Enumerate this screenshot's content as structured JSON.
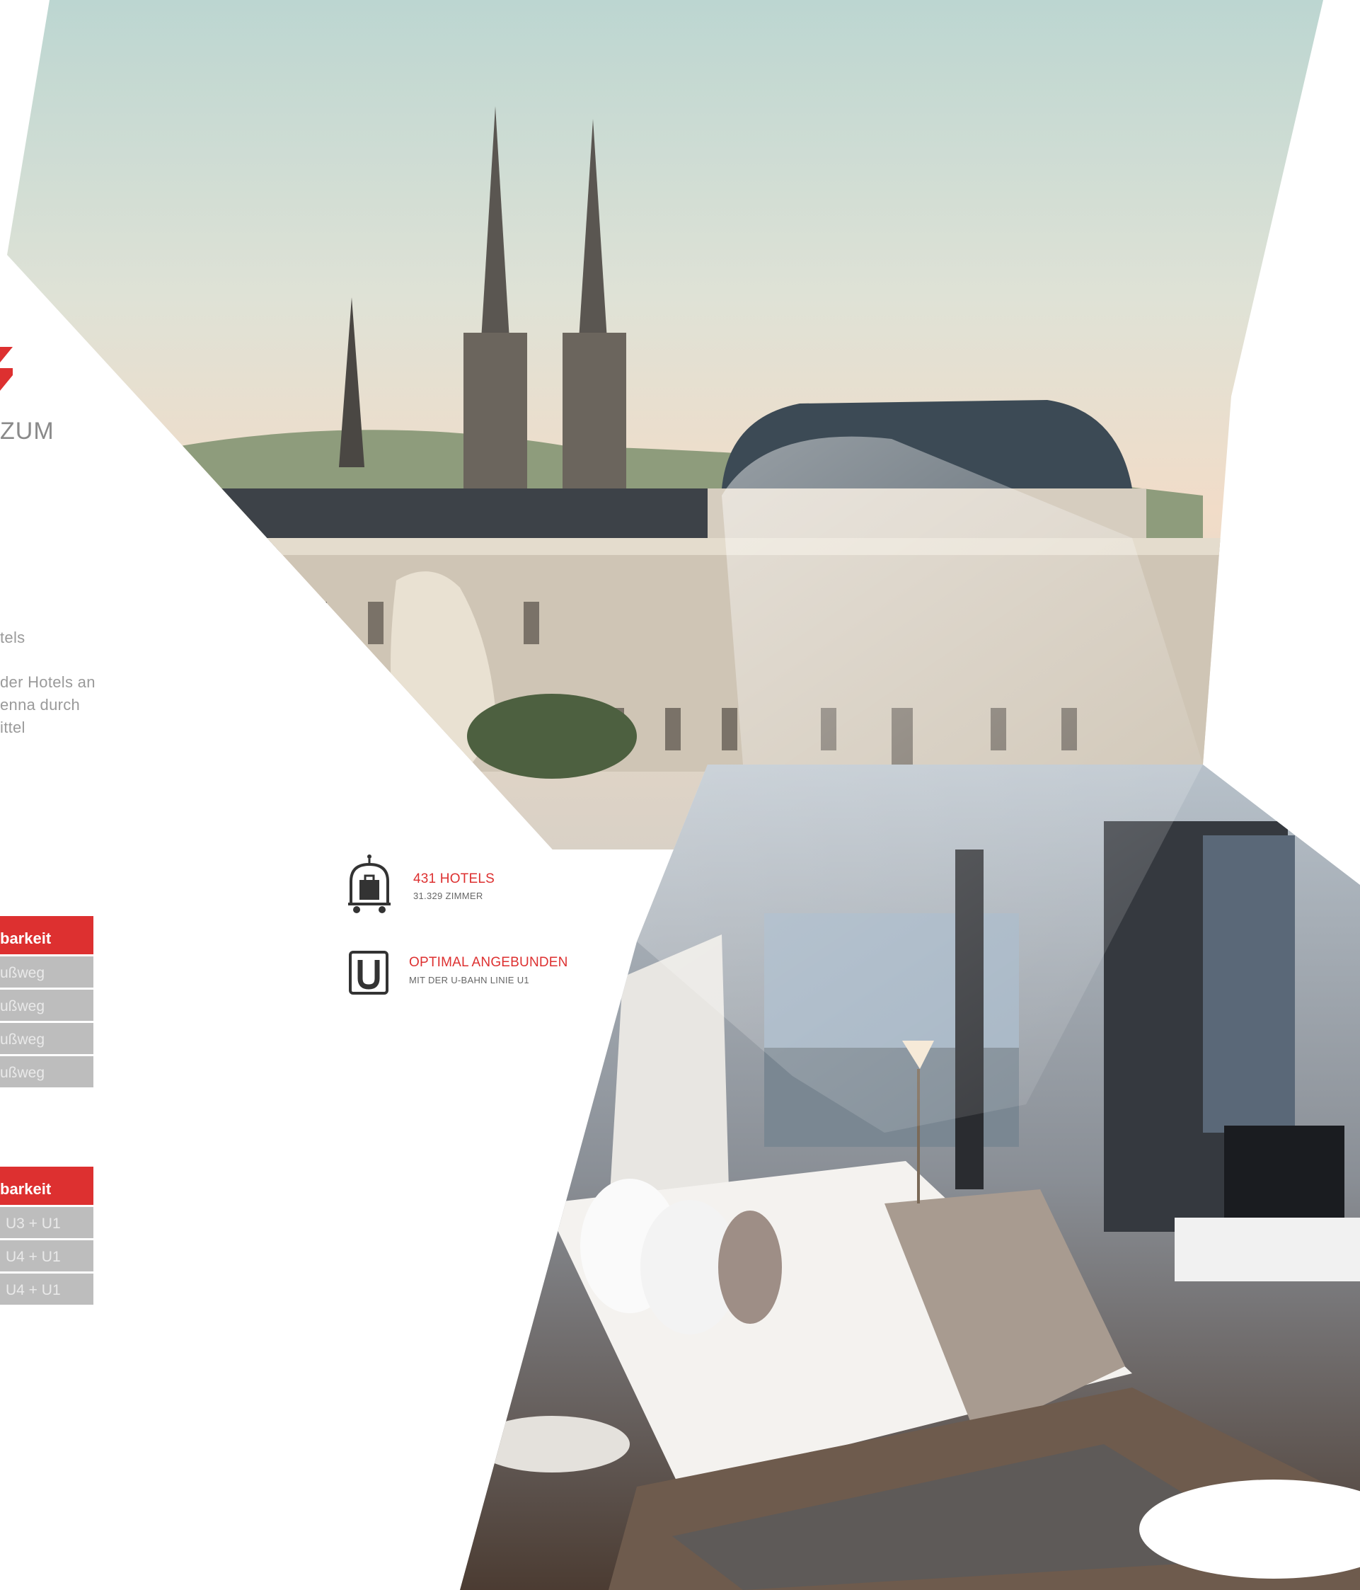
{
  "colors": {
    "accent": "#dd3030",
    "text_gray": "#9a9a9a",
    "row_gray": "#bdbdbd"
  },
  "intro": {
    "heading_fragment": "ZUM",
    "lines": [
      "tels",
      "der Hotels an",
      "enna durch",
      "ittel"
    ]
  },
  "table_walk": {
    "header": "barkeit",
    "rows": [
      "ußweg",
      "ußweg",
      "ußweg",
      "ußweg"
    ]
  },
  "table_transit": {
    "header": "barkeit",
    "rows": [
      "U3 + U1",
      "U4 + U1",
      "U4 + U1"
    ]
  },
  "facts": [
    {
      "icon": "hotel-luggage-cart-icon",
      "title": "431 HOTELS",
      "subtitle": "31.329 ZIMMER"
    },
    {
      "icon": "u-bahn-icon",
      "title": "OPTIMAL ANGEBUNDEN",
      "subtitle": "MIT DER U-BAHN LINIE U1"
    }
  ]
}
